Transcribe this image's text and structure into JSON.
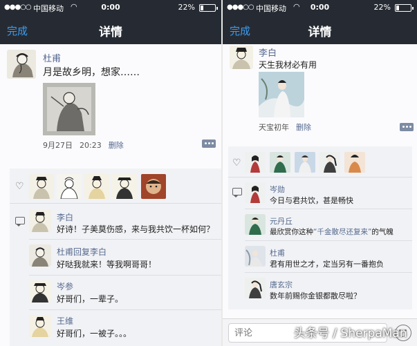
{
  "status_bar": {
    "signal_dots": "●●●○○",
    "carrier": "中国移动",
    "wifi_icon": "wifi-icon",
    "time": "0:00",
    "battery_percent": "22%",
    "battery_level": 0.22
  },
  "left_screen": {
    "nav": {
      "done_label": "完成",
      "title": "详情"
    },
    "post": {
      "author": "杜甫",
      "text": "月是故乡明，想家……",
      "date": "9月27日",
      "time": "20:23",
      "delete_label": "删除"
    },
    "likes_count": 5,
    "comments": [
      {
        "author": "李白",
        "text": "好诗！子美莫伤感，来与我共饮一杯如何？"
      },
      {
        "author": "杜甫回复李白",
        "text": "好哒我就来！等我啊哥哥！"
      },
      {
        "author": "岑参",
        "text": "好哥们，一辈子。"
      },
      {
        "author": "王维",
        "text": "好哥们，一被子。。。"
      }
    ]
  },
  "right_screen": {
    "nav": {
      "done_label": "完成",
      "title": "详情"
    },
    "post": {
      "author": "李白",
      "text": "天生我材必有用",
      "date": "天宝初年",
      "delete_label": "删除"
    },
    "likes_count": 5,
    "comments": [
      {
        "author": "岑勋",
        "text": "今日与君共饮，甚是畅快"
      },
      {
        "author": "元丹丘",
        "text_before": "最欣赏你这种",
        "text_quote": "“千金散尽还复来”",
        "text_after": "的气魄"
      },
      {
        "author": "杜甫",
        "text": "君有用世之才，定当另有一番抱负"
      },
      {
        "author": "唐玄宗",
        "text": "数年前赐你金银都散尽啦？"
      }
    ],
    "composer": {
      "placeholder": "评论"
    }
  },
  "watermark": "头条号 / SherpaMan",
  "colors": {
    "nav_bg": "#262b33",
    "link_blue": "#3d9cf0",
    "name_blue": "#55698f",
    "panel_bg": "#f1f2f5"
  }
}
